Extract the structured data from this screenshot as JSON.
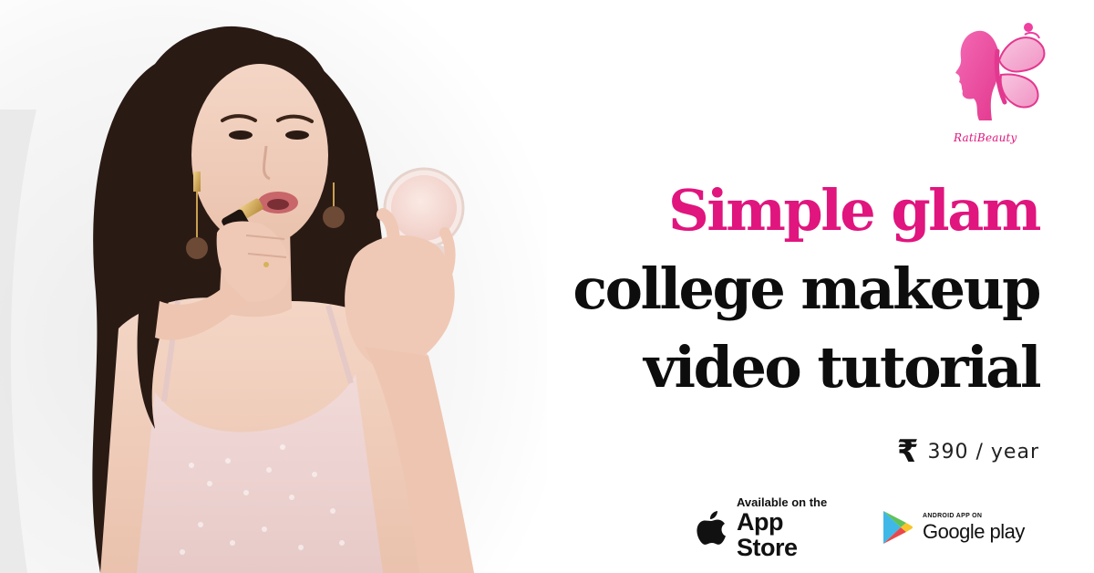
{
  "brand": {
    "name": "RatiBeauty",
    "accent_color": "#e0157e",
    "logo_color": "#ef3fa0",
    "logo_icon": "face-butterfly-logo"
  },
  "photo": {
    "icon": "woman-applying-lipstick-with-compact-mirror"
  },
  "headline": {
    "line1": "Simple glam",
    "line2": "college makeup",
    "line3": "video tutorial",
    "line1_color": "#e0157e",
    "text_color": "#0d0d0d"
  },
  "price": {
    "currency_symbol": "₹",
    "amount": "390 / year"
  },
  "stores": {
    "app_store": {
      "icon": "apple-icon",
      "small_text": "Available on the",
      "big_text": "App Store"
    },
    "google_play": {
      "icon": "google-play-icon",
      "small_text": "ANDROID APP ON",
      "big_text": "Google play"
    }
  }
}
